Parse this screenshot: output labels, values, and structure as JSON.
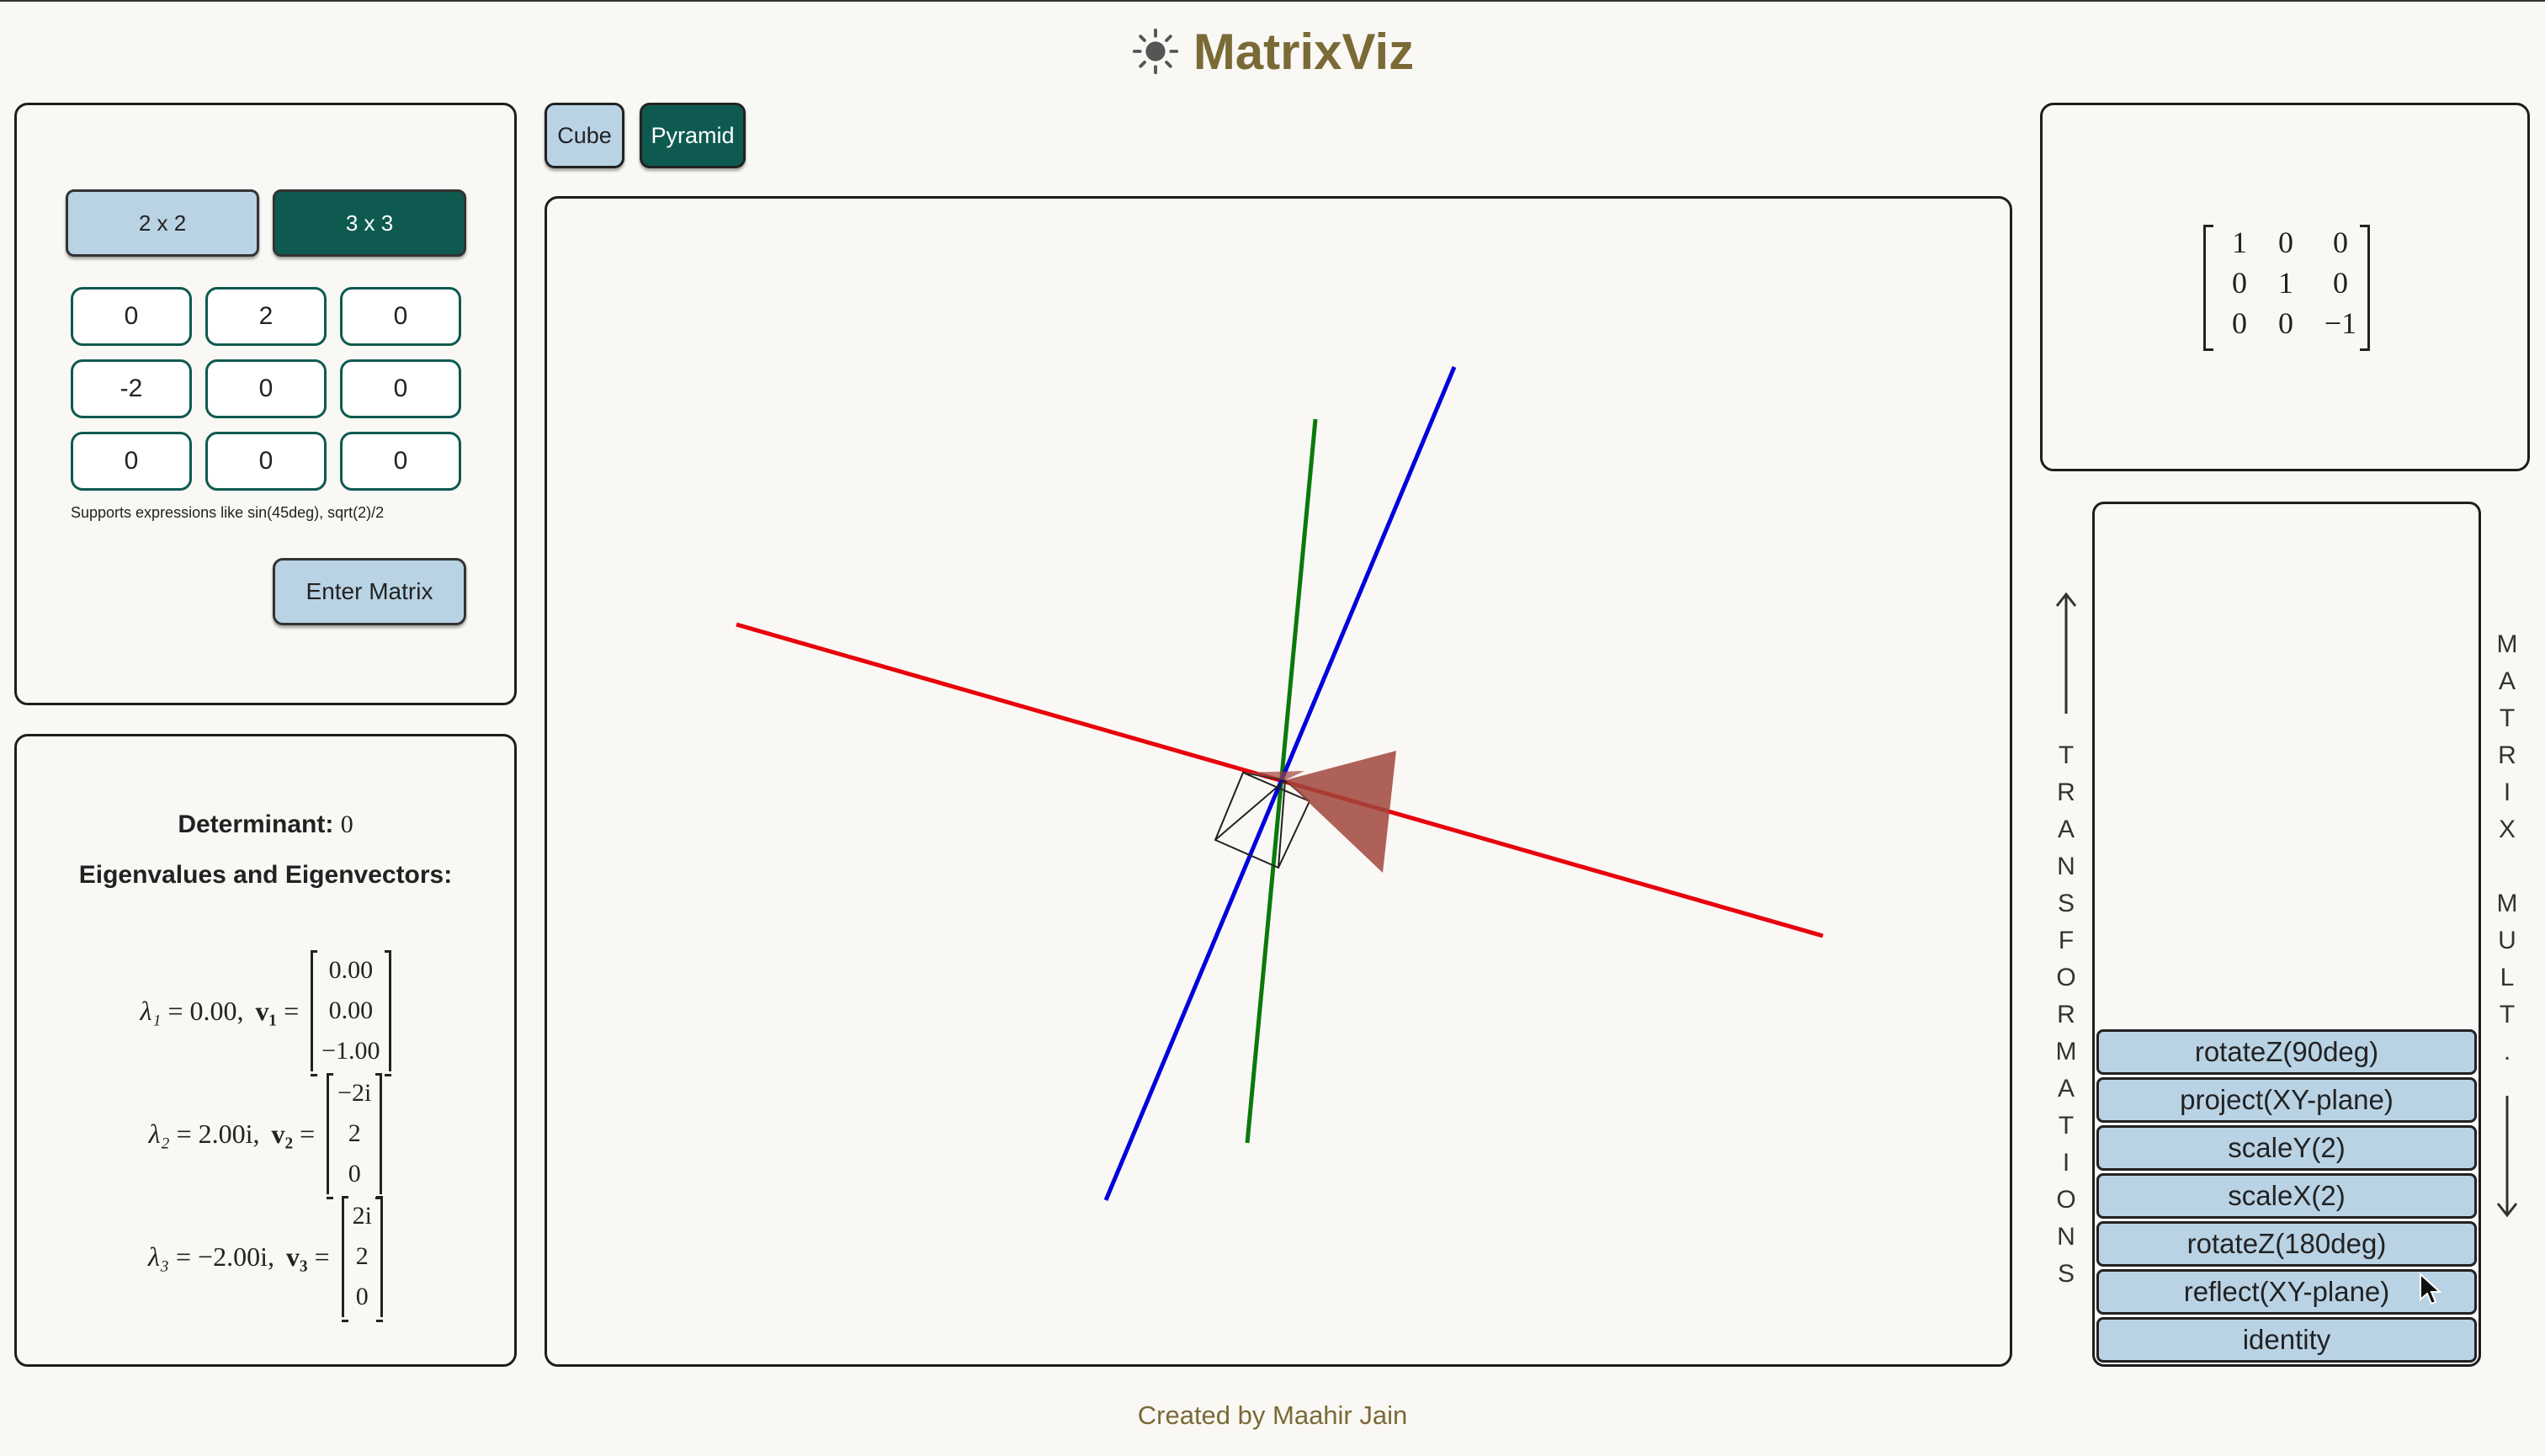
{
  "app": {
    "title": "MatrixViz",
    "footer": "Created by Maahir Jain"
  },
  "size_buttons": {
    "two": "2 x 2",
    "three": "3 x 3",
    "selected": "3 x 3"
  },
  "matrix_input": {
    "cells": [
      [
        "0",
        "2",
        "0"
      ],
      [
        "-2",
        "0",
        "0"
      ],
      [
        "0",
        "0",
        "0"
      ]
    ],
    "hint": "Supports expressions like sin(45deg), sqrt(2)/2",
    "enter_label": "Enter Matrix"
  },
  "info": {
    "determinant_label": "Determinant:",
    "determinant_value": "0",
    "eigen_heading": "Eigenvalues and Eigenvectors:",
    "eigen": [
      {
        "lambda": "λ₁",
        "value": "= 0.00,",
        "vec_name": "v₁",
        "vector": [
          "0.00",
          "0.00",
          "−1.00"
        ]
      },
      {
        "lambda": "λ₂",
        "value": "= 2.00i,",
        "vec_name": "v₂",
        "vector": [
          "−2i",
          "2",
          "0"
        ]
      },
      {
        "lambda": "λ₃",
        "value": "= −2.00i,",
        "vec_name": "v₃",
        "vector": [
          "2i",
          "2",
          "0"
        ]
      }
    ]
  },
  "shapes": {
    "cube": "Cube",
    "pyramid": "Pyramid",
    "selected": "Pyramid"
  },
  "viewport": {
    "x_axis_color": "#e8000b",
    "y_axis_color": "#0a7a0a",
    "z_axis_color": "#0000dd",
    "shape_color": "#a0463c"
  },
  "current_matrix": [
    [
      "1",
      "0",
      "0"
    ],
    [
      "0",
      "1",
      "0"
    ],
    [
      "0",
      "0",
      "−1"
    ]
  ],
  "stack": {
    "left_label": "TRANSFORMATIONS",
    "right_label": "MATRIX MULT.",
    "items": [
      "rotateZ(90deg)",
      "project(XY-plane)",
      "scaleY(2)",
      "scaleX(2)",
      "rotateZ(180deg)",
      "reflect(XY-plane)",
      "identity"
    ]
  }
}
